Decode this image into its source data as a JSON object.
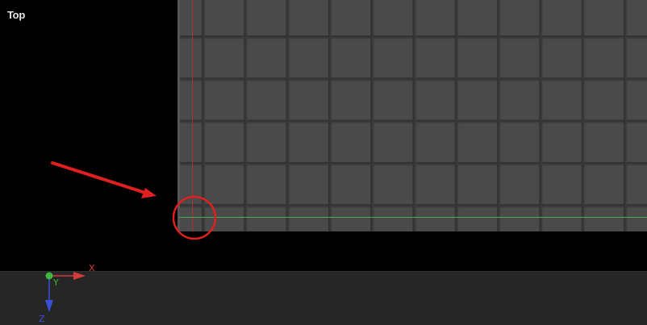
{
  "viewport": {
    "label": "Top"
  },
  "gizmo": {
    "x_label": "X",
    "y_label": "Y",
    "z_label": "Z",
    "x_color": "#d43a3a",
    "y_color": "#3fb83f",
    "z_color": "#3a4fd8"
  },
  "annotation": {
    "color": "#e02020",
    "arrow_icon": "arrow-icon",
    "circle_icon": "circle-highlight-icon"
  },
  "colors": {
    "background": "#000000",
    "grid_plane": "#4a4a4a",
    "grid_lines": "#303030",
    "bottom_panel": "#262626"
  }
}
